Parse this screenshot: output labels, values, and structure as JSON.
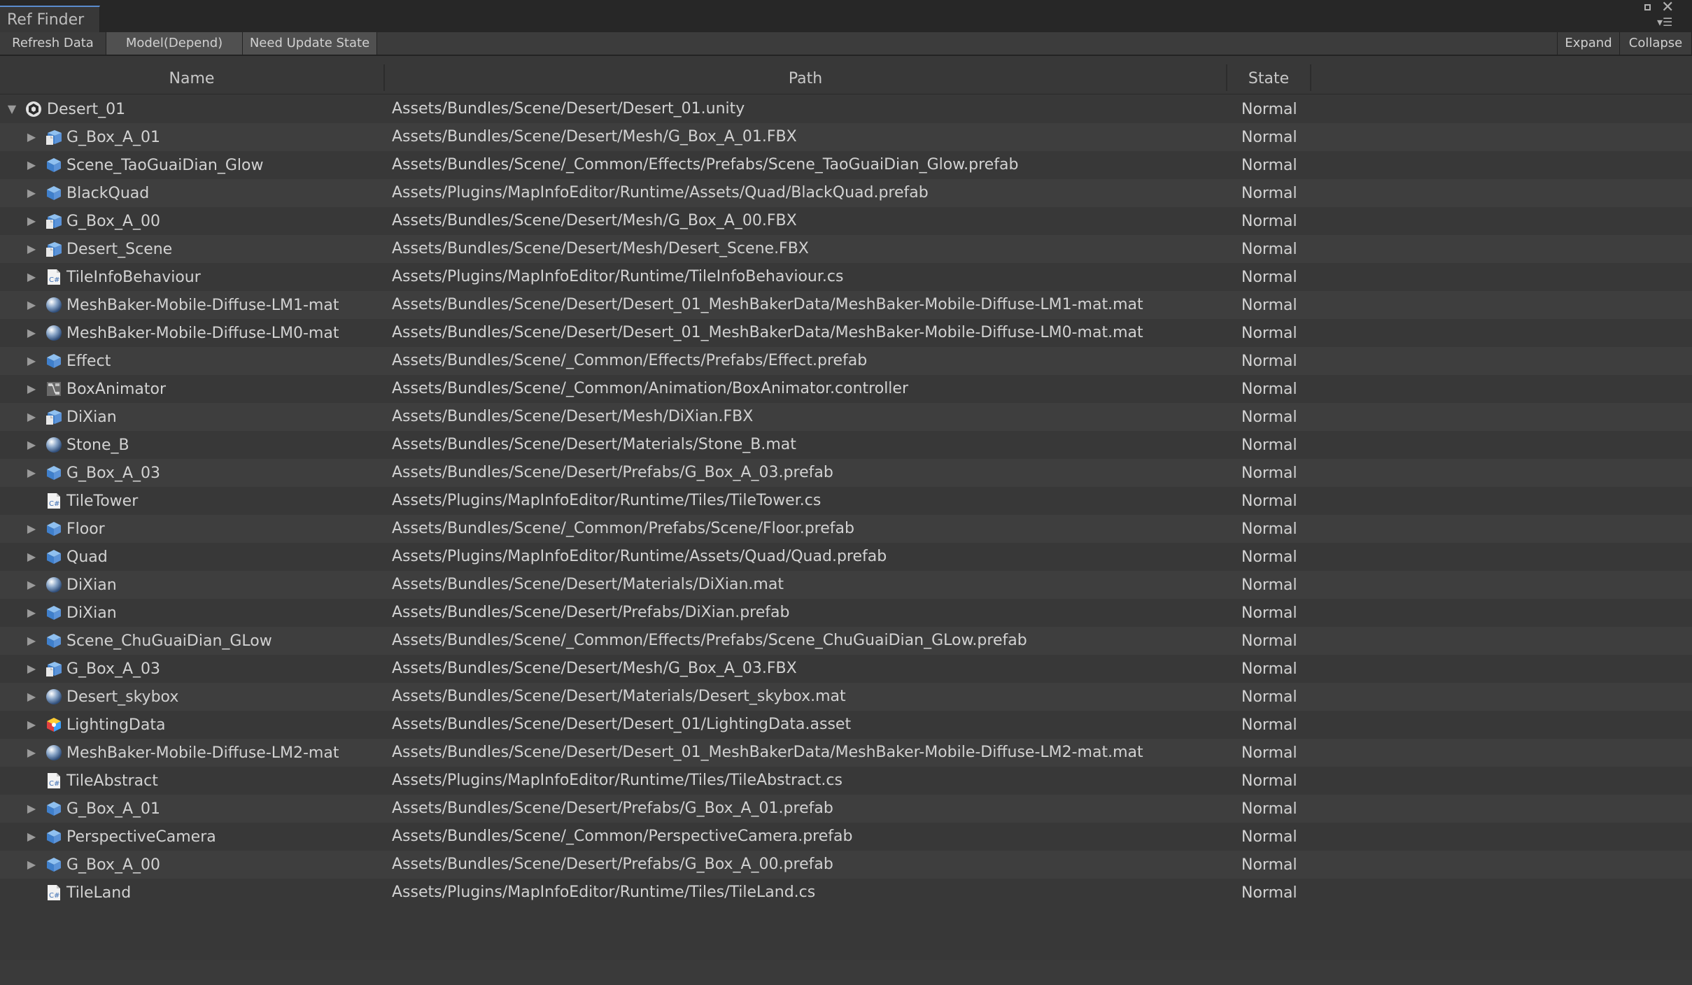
{
  "window": {
    "tab_title": "Ref Finder"
  },
  "toolbar": {
    "refresh": "Refresh Data",
    "model": "Model(Depend)",
    "need_update": "Need Update State",
    "expand": "Expand",
    "collapse": "Collapse"
  },
  "columns": {
    "name": "Name",
    "path": "Path",
    "state": "State"
  },
  "rows": [
    {
      "name": "Desert_01",
      "path": "Assets/Bundles/Scene/Desert/Desert_01.unity",
      "state": "Normal",
      "icon": "unity-scene-icon",
      "level": 0,
      "arrow": "expanded"
    },
    {
      "name": "G_Box_A_01",
      "path": "Assets/Bundles/Scene/Desert/Mesh/G_Box_A_01.FBX",
      "state": "Normal",
      "icon": "model-icon",
      "level": 1,
      "arrow": "collapsed"
    },
    {
      "name": "Scene_TaoGuaiDian_Glow",
      "path": "Assets/Bundles/Scene/_Common/Effects/Prefabs/Scene_TaoGuaiDian_Glow.prefab",
      "state": "Normal",
      "icon": "prefab-icon",
      "level": 1,
      "arrow": "collapsed"
    },
    {
      "name": "BlackQuad",
      "path": "Assets/Plugins/MapInfoEditor/Runtime/Assets/Quad/BlackQuad.prefab",
      "state": "Normal",
      "icon": "prefab-icon",
      "level": 1,
      "arrow": "collapsed"
    },
    {
      "name": "G_Box_A_00",
      "path": "Assets/Bundles/Scene/Desert/Mesh/G_Box_A_00.FBX",
      "state": "Normal",
      "icon": "model-icon",
      "level": 1,
      "arrow": "collapsed"
    },
    {
      "name": "Desert_Scene",
      "path": "Assets/Bundles/Scene/Desert/Mesh/Desert_Scene.FBX",
      "state": "Normal",
      "icon": "model-icon",
      "level": 1,
      "arrow": "collapsed"
    },
    {
      "name": "TileInfoBehaviour",
      "path": "Assets/Plugins/MapInfoEditor/Runtime/TileInfoBehaviour.cs",
      "state": "Normal",
      "icon": "csharp-script-icon",
      "level": 1,
      "arrow": "collapsed"
    },
    {
      "name": "MeshBaker-Mobile-Diffuse-LM1-mat",
      "path": "Assets/Bundles/Scene/Desert/Desert_01_MeshBakerData/MeshBaker-Mobile-Diffuse-LM1-mat.mat",
      "state": "Normal",
      "icon": "material-icon",
      "level": 1,
      "arrow": "collapsed"
    },
    {
      "name": "MeshBaker-Mobile-Diffuse-LM0-mat",
      "path": "Assets/Bundles/Scene/Desert/Desert_01_MeshBakerData/MeshBaker-Mobile-Diffuse-LM0-mat.mat",
      "state": "Normal",
      "icon": "material-icon",
      "level": 1,
      "arrow": "collapsed"
    },
    {
      "name": "Effect",
      "path": "Assets/Bundles/Scene/_Common/Effects/Prefabs/Effect.prefab",
      "state": "Normal",
      "icon": "prefab-icon",
      "level": 1,
      "arrow": "collapsed"
    },
    {
      "name": "BoxAnimator",
      "path": "Assets/Bundles/Scene/_Common/Animation/BoxAnimator.controller",
      "state": "Normal",
      "icon": "animator-controller-icon",
      "level": 1,
      "arrow": "collapsed"
    },
    {
      "name": "DiXian",
      "path": "Assets/Bundles/Scene/Desert/Mesh/DiXian.FBX",
      "state": "Normal",
      "icon": "model-icon",
      "level": 1,
      "arrow": "collapsed"
    },
    {
      "name": "Stone_B",
      "path": "Assets/Bundles/Scene/Desert/Materials/Stone_B.mat",
      "state": "Normal",
      "icon": "material-icon",
      "level": 1,
      "arrow": "collapsed"
    },
    {
      "name": "G_Box_A_03",
      "path": "Assets/Bundles/Scene/Desert/Prefabs/G_Box_A_03.prefab",
      "state": "Normal",
      "icon": "prefab-icon",
      "level": 1,
      "arrow": "collapsed"
    },
    {
      "name": "TileTower",
      "path": "Assets/Plugins/MapInfoEditor/Runtime/Tiles/TileTower.cs",
      "state": "Normal",
      "icon": "csharp-script-icon",
      "level": 1,
      "arrow": "none"
    },
    {
      "name": "Floor",
      "path": "Assets/Bundles/Scene/_Common/Prefabs/Scene/Floor.prefab",
      "state": "Normal",
      "icon": "prefab-icon",
      "level": 1,
      "arrow": "collapsed"
    },
    {
      "name": "Quad",
      "path": "Assets/Plugins/MapInfoEditor/Runtime/Assets/Quad/Quad.prefab",
      "state": "Normal",
      "icon": "prefab-icon",
      "level": 1,
      "arrow": "collapsed"
    },
    {
      "name": "DiXian",
      "path": "Assets/Bundles/Scene/Desert/Materials/DiXian.mat",
      "state": "Normal",
      "icon": "material-icon",
      "level": 1,
      "arrow": "collapsed"
    },
    {
      "name": "DiXian",
      "path": "Assets/Bundles/Scene/Desert/Prefabs/DiXian.prefab",
      "state": "Normal",
      "icon": "prefab-icon",
      "level": 1,
      "arrow": "collapsed"
    },
    {
      "name": "Scene_ChuGuaiDian_GLow",
      "path": "Assets/Bundles/Scene/_Common/Effects/Prefabs/Scene_ChuGuaiDian_GLow.prefab",
      "state": "Normal",
      "icon": "prefab-icon",
      "level": 1,
      "arrow": "collapsed"
    },
    {
      "name": "G_Box_A_03",
      "path": "Assets/Bundles/Scene/Desert/Mesh/G_Box_A_03.FBX",
      "state": "Normal",
      "icon": "model-icon",
      "level": 1,
      "arrow": "collapsed"
    },
    {
      "name": "Desert_skybox",
      "path": "Assets/Bundles/Scene/Desert/Materials/Desert_skybox.mat",
      "state": "Normal",
      "icon": "material-icon",
      "level": 1,
      "arrow": "collapsed"
    },
    {
      "name": "LightingData",
      "path": "Assets/Bundles/Scene/Desert/Desert_01/LightingData.asset",
      "state": "Normal",
      "icon": "lighting-data-icon",
      "level": 1,
      "arrow": "collapsed"
    },
    {
      "name": "MeshBaker-Mobile-Diffuse-LM2-mat",
      "path": "Assets/Bundles/Scene/Desert/Desert_01_MeshBakerData/MeshBaker-Mobile-Diffuse-LM2-mat.mat",
      "state": "Normal",
      "icon": "material-icon",
      "level": 1,
      "arrow": "collapsed"
    },
    {
      "name": "TileAbstract",
      "path": "Assets/Plugins/MapInfoEditor/Runtime/Tiles/TileAbstract.cs",
      "state": "Normal",
      "icon": "csharp-script-icon",
      "level": 1,
      "arrow": "none"
    },
    {
      "name": "G_Box_A_01",
      "path": "Assets/Bundles/Scene/Desert/Prefabs/G_Box_A_01.prefab",
      "state": "Normal",
      "icon": "prefab-icon",
      "level": 1,
      "arrow": "collapsed"
    },
    {
      "name": "PerspectiveCamera",
      "path": "Assets/Bundles/Scene/_Common/PerspectiveCamera.prefab",
      "state": "Normal",
      "icon": "prefab-icon",
      "level": 1,
      "arrow": "collapsed"
    },
    {
      "name": "G_Box_A_00",
      "path": "Assets/Bundles/Scene/Desert/Prefabs/G_Box_A_00.prefab",
      "state": "Normal",
      "icon": "prefab-icon",
      "level": 1,
      "arrow": "collapsed"
    },
    {
      "name": "TileLand",
      "path": "Assets/Plugins/MapInfoEditor/Runtime/Tiles/TileLand.cs",
      "state": "Normal",
      "icon": "csharp-script-icon",
      "level": 1,
      "arrow": "none"
    }
  ],
  "colors": {
    "background": "#383838",
    "row_alt": "#3e3e3e",
    "tab_accent": "#5a8ccd",
    "prefab_blue": "#5b93d8"
  }
}
